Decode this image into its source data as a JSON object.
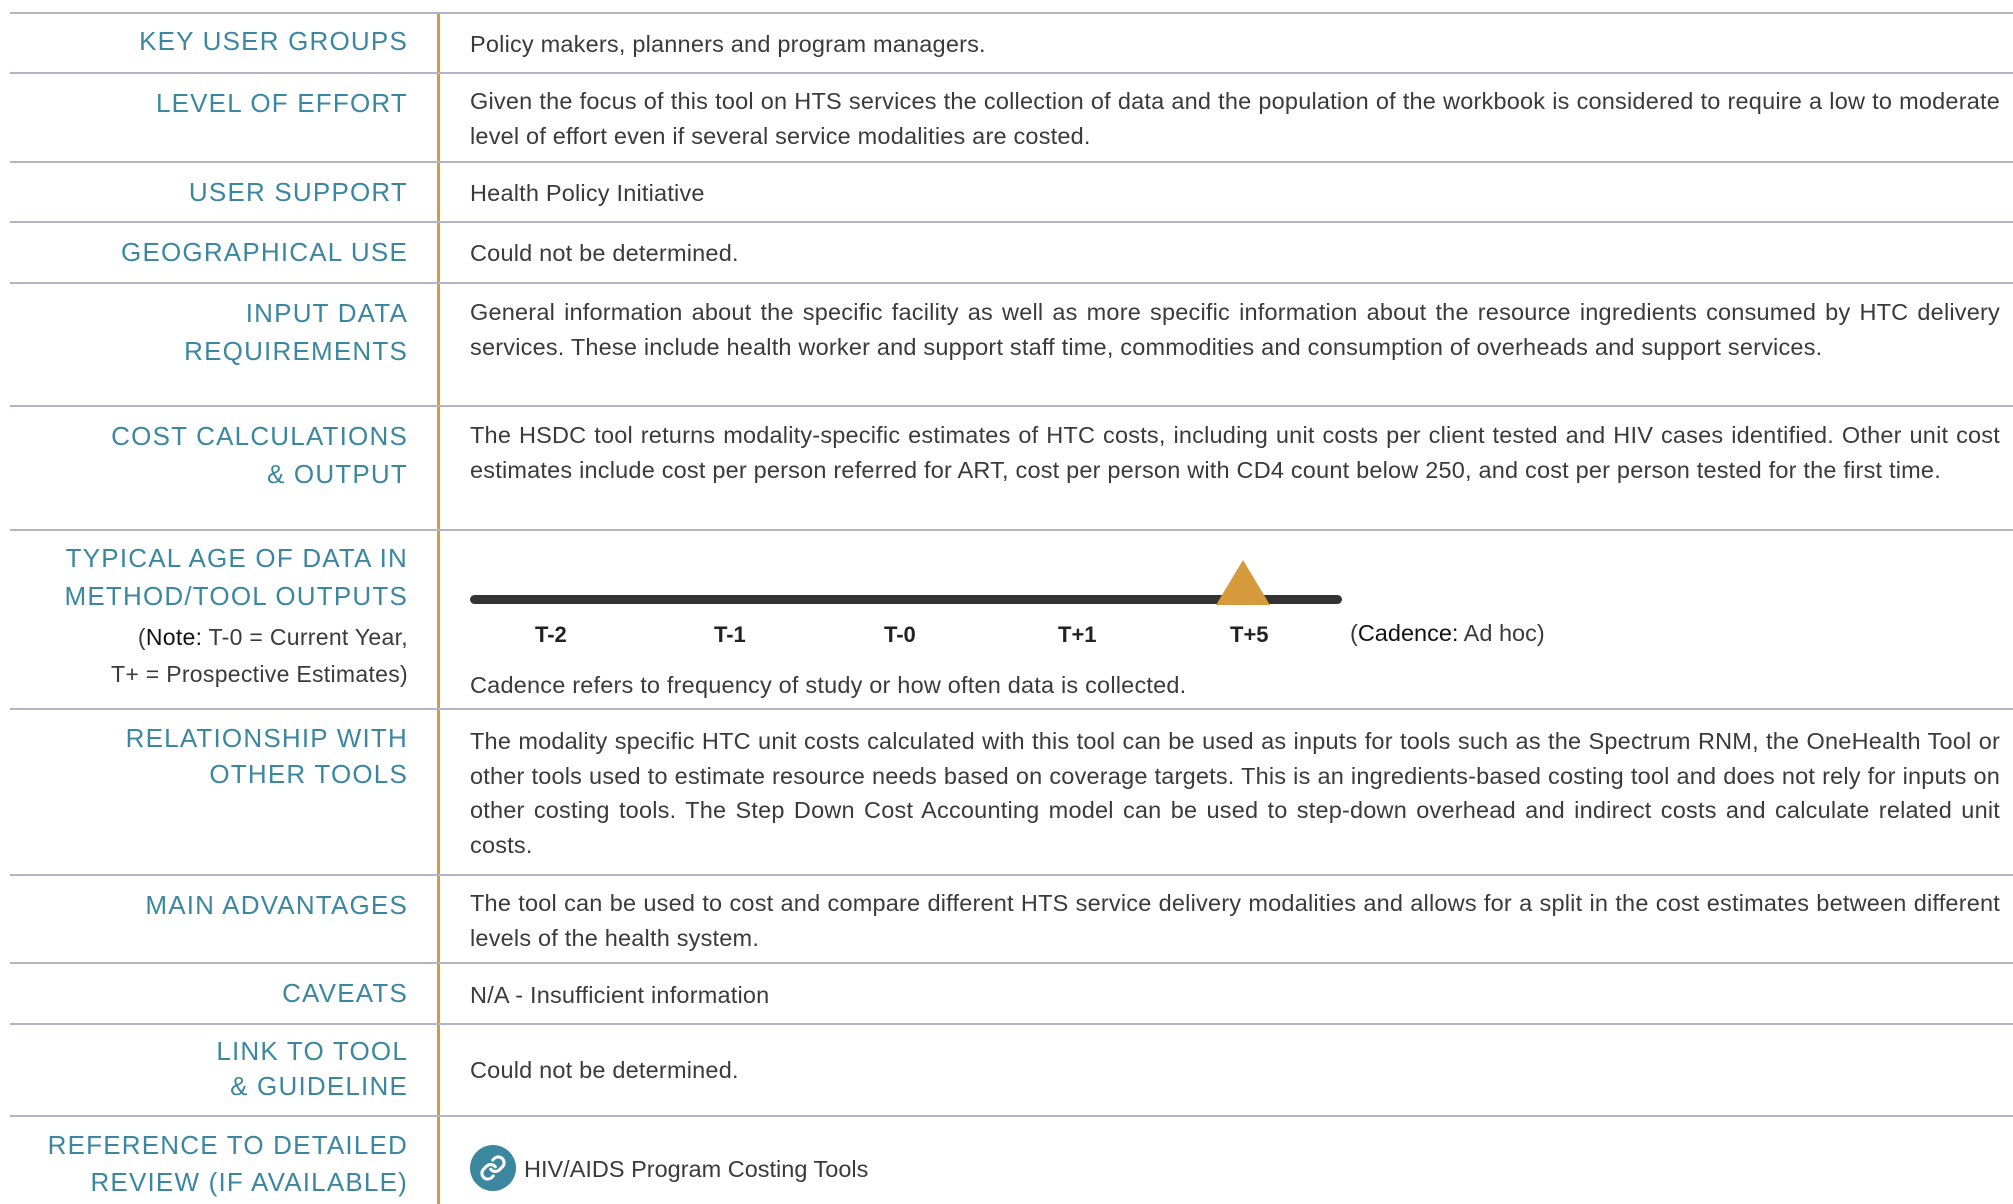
{
  "rows": [
    {
      "label": "KEY USER GROUPS",
      "content": "Policy makers, planners and program managers."
    },
    {
      "label": "LEVEL OF EFFORT",
      "content": "Given the focus of this tool on HTS services the collection of data and the population of the workbook is considered to require a low to moderate level of effort even if several service modalities are costed."
    },
    {
      "label": "USER SUPPORT",
      "content": "Health Policy Initiative"
    },
    {
      "label": "GEOGRAPHICAL USE",
      "content": "Could not be determined."
    },
    {
      "label_line1": "INPUT DATA",
      "label_line2": "REQUIREMENTS",
      "content": "General information about the specific facility as well as more specific information about the resource ingredients consumed by HTC delivery services. These include health worker and support staff time, commodities and consumption of overheads and support services."
    },
    {
      "label_line1": "COST CALCULATIONS",
      "label_line2": "& OUTPUT",
      "content": "The HSDC tool returns modality-specific estimates of HTC costs, including unit costs per client tested and HIV cases identified. Other unit cost estimates include cost per person referred for ART, cost per person with CD4 count below 250, and cost per person tested for the first time."
    },
    {
      "label_line1": "TYPICAL AGE OF DATA IN",
      "label_line2": "METHOD/TOOL OUTPUTS",
      "note_open": "(",
      "note_bold": "Note:",
      "note_rest": " T-0 = Current Year,",
      "note_line2": "T+ = Prospective Estimates)",
      "content": "Cadence refers to frequency of study or how often data is collected."
    },
    {
      "label_line1": "RELATIONSHIP WITH",
      "label_line2": "OTHER TOOLS",
      "content": "The modality specific HTC unit costs calculated with this tool can be used as inputs for tools such as the Spectrum RNM, the OneHealth Tool or other tools used to estimate resource needs based on coverage targets. This is an ingredients-based costing tool and does not rely for inputs on other costing tools. The Step Down Cost Accounting model can be used to step-down overhead and indirect costs and calculate related unit costs."
    },
    {
      "label": "MAIN ADVANTAGES",
      "content": "The tool can be used to cost and compare different HTS service delivery modalities and allows for a split in the cost estimates between different levels of the health system."
    },
    {
      "label": "CAVEATS",
      "content": "N/A - Insufficient information"
    },
    {
      "label_line1": "LINK TO TOOL",
      "label_line2": "& GUIDELINE",
      "content": "Could not be determined."
    },
    {
      "label_line1": "REFERENCE TO DETAILED",
      "label_line2": "REVIEW (IF AVAILABLE)",
      "link_text": "HIV/AIDS Program Costing Tools",
      "link_icon": "link-icon"
    }
  ],
  "timeline": {
    "ticks": [
      "T-2",
      "T-1",
      "T-0",
      "T+1",
      "T+5"
    ],
    "marker_at": "T+5",
    "cadence_open": "(",
    "cadence_label": "Cadence:",
    "cadence_value": " Ad hoc)"
  },
  "colors": {
    "label": "#3b87a0",
    "accent": "#d49a3c",
    "rule": "#b4b4c8",
    "text": "#3a3a3a"
  }
}
